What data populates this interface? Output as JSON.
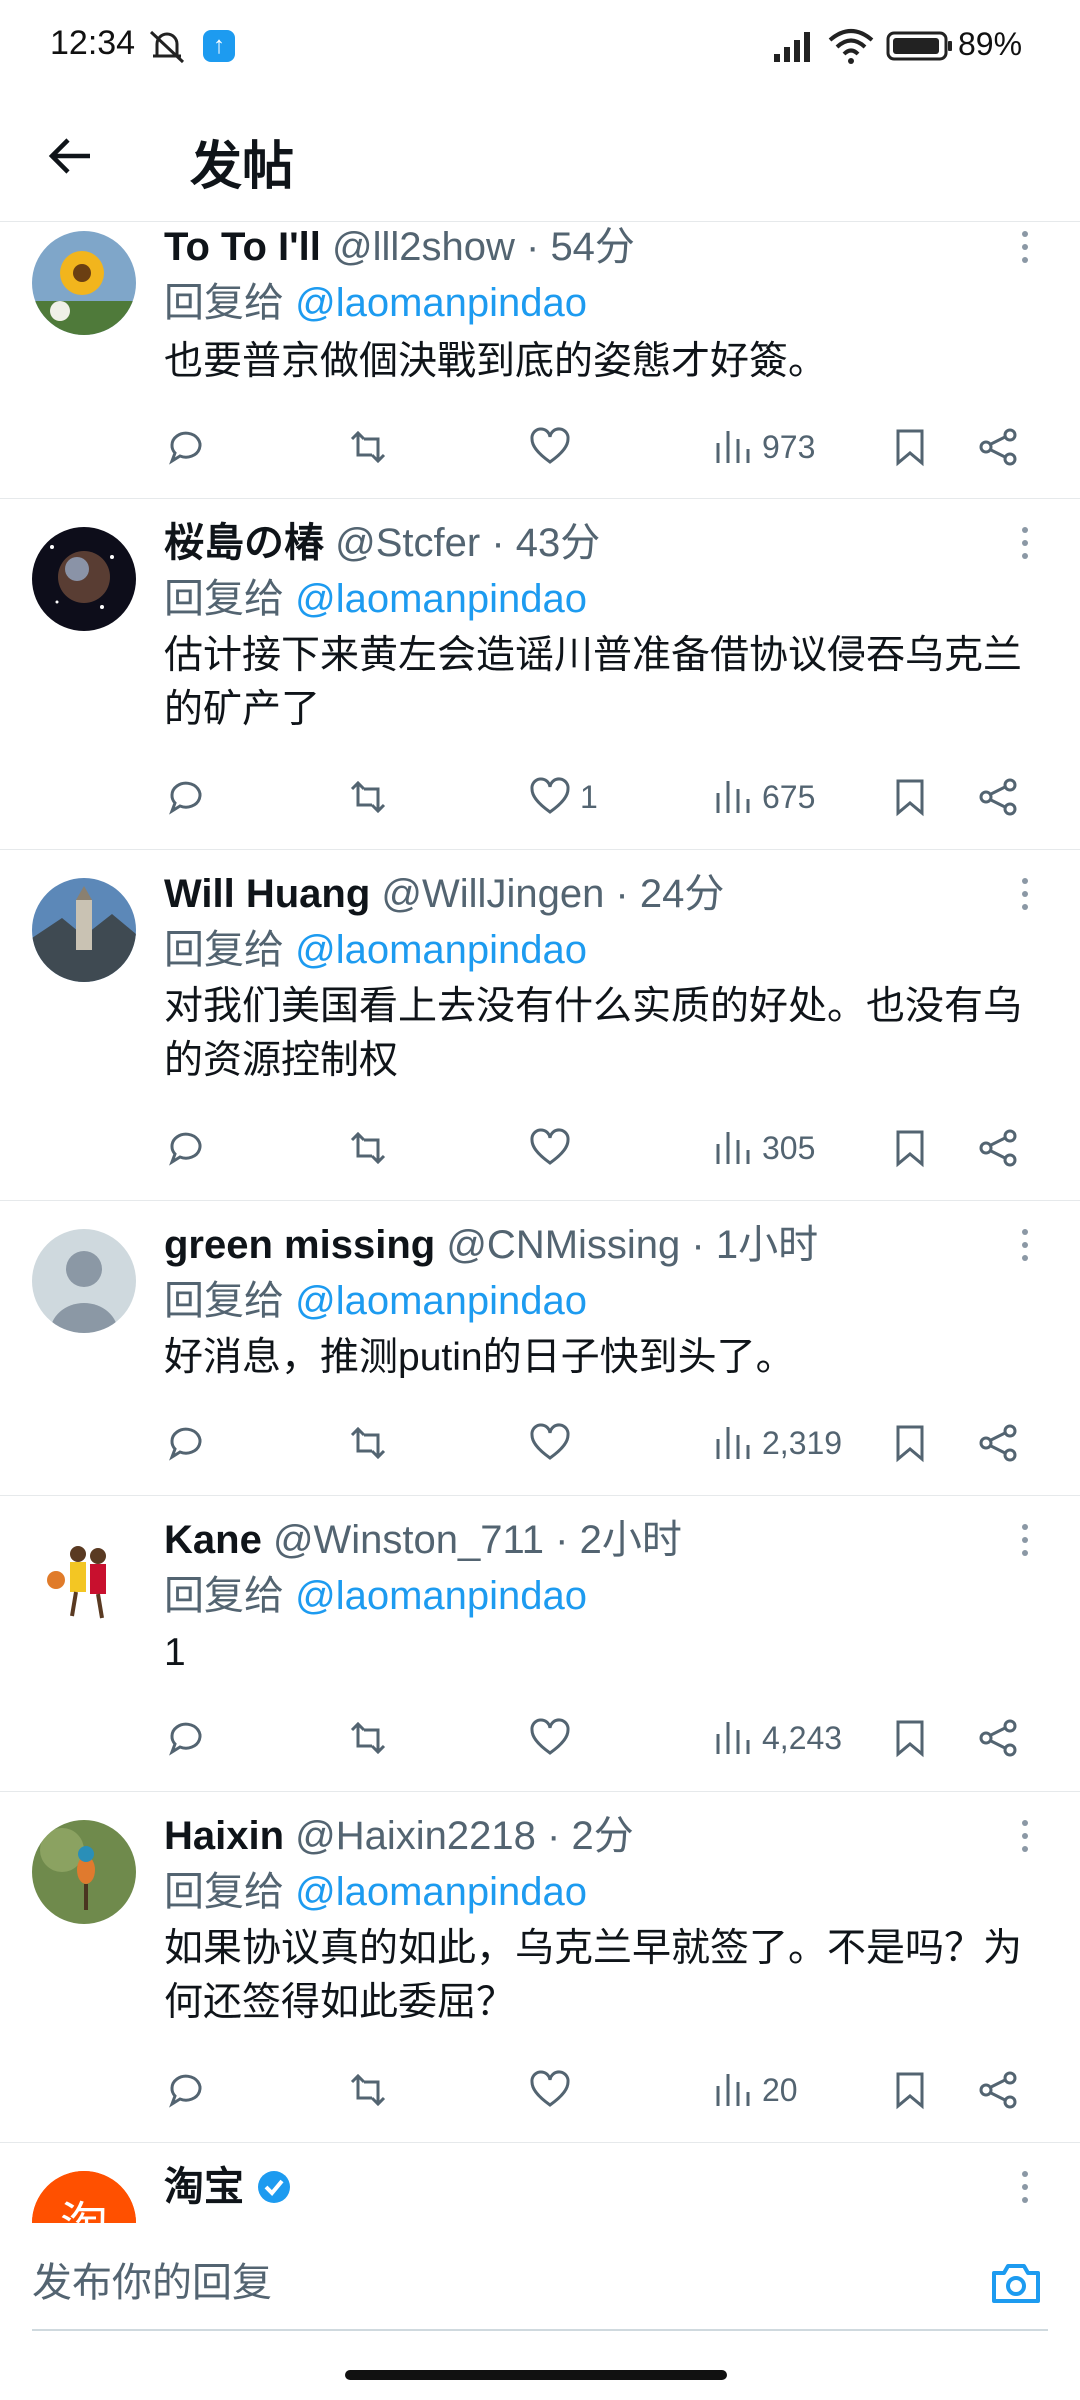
{
  "status_bar": {
    "time": "12:34",
    "battery": "89%"
  },
  "header": {
    "title": "发帖"
  },
  "replying_label": "回复给",
  "replies": [
    {
      "name": "To To I'll",
      "handle_time": "@lll2show · 54分",
      "mention": "@laomanpindao",
      "text": "也要普京做個決戰到底的姿態才好簽。",
      "likes": "",
      "views": "973"
    },
    {
      "name": "桜島の椿",
      "handle_time": "@Stcfer · 43分",
      "mention": "@laomanpindao",
      "text": "估计接下来黄左会造谣川普准备借协议侵吞乌克兰的矿产了",
      "likes": "1",
      "views": "675"
    },
    {
      "name": "Will Huang",
      "handle_time": "@WillJingen · 24分",
      "mention": "@laomanpindao",
      "text": "对我们美国看上去没有什么实质的好处。也没有乌的资源控制权",
      "likes": "",
      "views": "305"
    },
    {
      "name": "green missing",
      "handle_time": "@CNMissing · 1小时",
      "mention": "@laomanpindao",
      "text": "好消息，推测putin的日子快到头了。",
      "likes": "",
      "views": "2,319"
    },
    {
      "name": "Kane",
      "handle_time": "@Winston_711 · 2小时",
      "mention": "@laomanpindao",
      "text": "1",
      "likes": "",
      "views": "4,243"
    },
    {
      "name": "Haixin",
      "handle_time": "@Haixin2218 · 2分",
      "mention": "@laomanpindao",
      "text": "如果协议真的如此，乌克兰早就签了。不是吗？为何还签得如此委屈？",
      "likes": "",
      "views": "20"
    },
    {
      "name": "淘宝",
      "handle_time": "",
      "mention": "",
      "text": "",
      "likes": "",
      "views": ""
    }
  ],
  "compose": {
    "placeholder": "发布你的回复"
  },
  "colors": {
    "accent": "#1d9bf0",
    "secondary_text": "#536471",
    "divider": "#e6e9eb",
    "taobao_orange": "#ff5000"
  },
  "icons": [
    "back-arrow-icon",
    "reply-icon",
    "retweet-icon",
    "like-icon",
    "views-icon",
    "bookmark-icon",
    "share-icon",
    "more-icon",
    "verified-badge-icon",
    "camera-icon"
  ]
}
